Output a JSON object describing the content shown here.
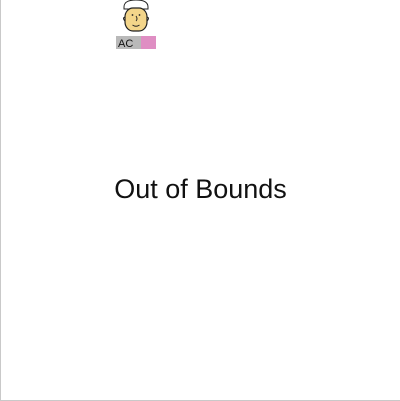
{
  "game": {
    "status_message": "Out of Bounds",
    "character": {
      "icon": "chef-character-icon",
      "label": "AC"
    }
  },
  "colors": {
    "background": "#ffffff",
    "border": "#c9c9c9",
    "text": "#111111",
    "skin": "#f3d58a",
    "plate": "#b9b9b9",
    "accent_pink": "#f07cc8"
  }
}
